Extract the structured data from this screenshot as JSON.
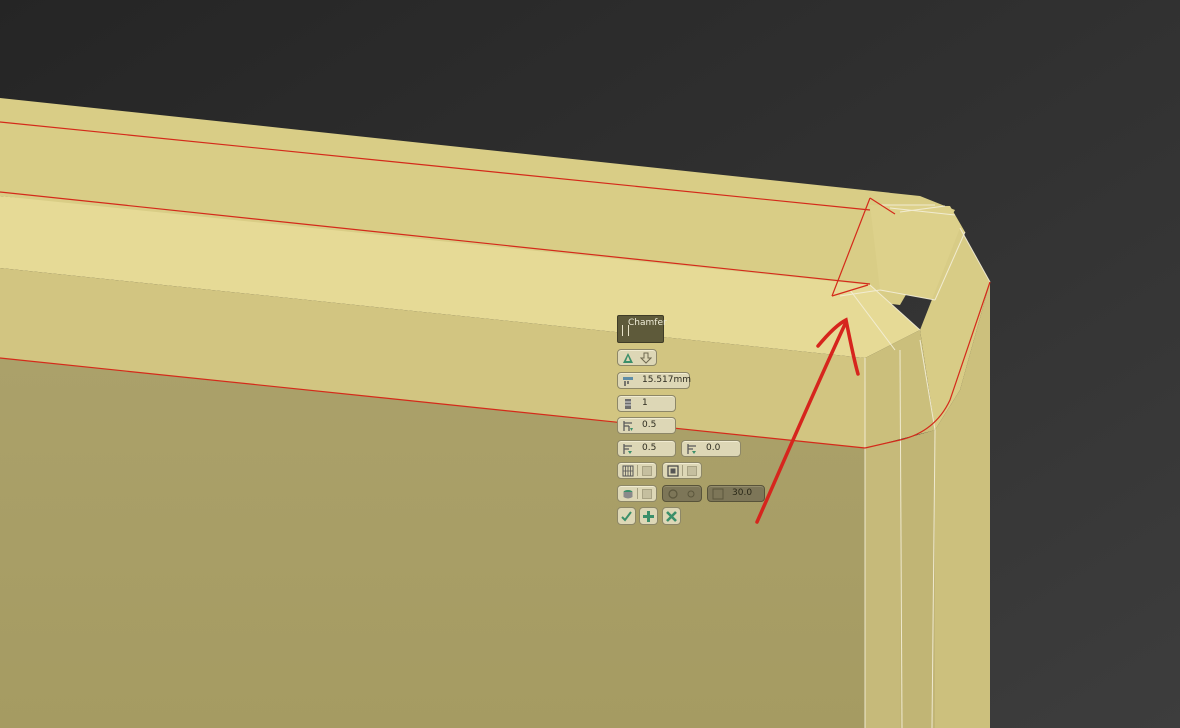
{
  "viewport": {
    "colors": {
      "background": "#2a2a2a",
      "face_top": "#e4d894",
      "face_front": "#aaa068",
      "edge_selected": "#d42a1a",
      "annotation_arrow": "#d6251d"
    }
  },
  "caddy": {
    "title": "Chamfer",
    "amount_value": "15.517mm",
    "segments_value": "1",
    "tension_value": "0.5",
    "depth_value": "0.5",
    "end_bias_value": "0.0",
    "angle_value": "30.0",
    "icons": {
      "type": "chamfer-type-icon",
      "amount": "amount-icon",
      "segments": "segments-icon",
      "tension": "tension-icon",
      "depth": "depth-icon",
      "end_bias": "end-bias-icon",
      "smooth": "smoothing-icon",
      "ok": "check-icon",
      "apply": "plus-icon",
      "cancel": "x-icon"
    }
  }
}
